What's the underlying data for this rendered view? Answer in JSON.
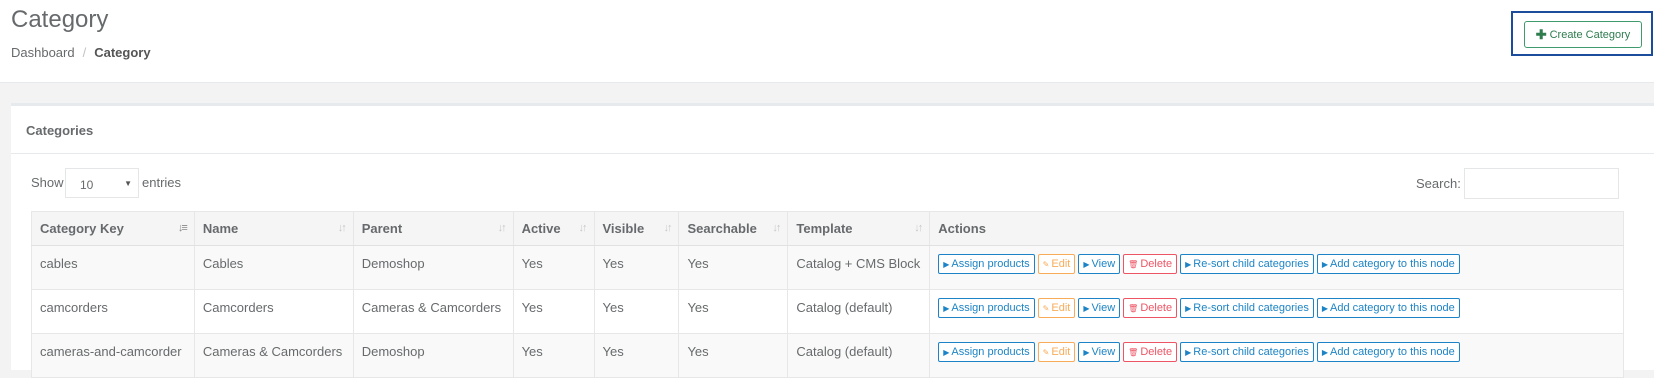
{
  "page": {
    "title": "Category",
    "breadcrumb": [
      "Dashboard",
      "Category"
    ],
    "create_button": "Create Category"
  },
  "box": {
    "title": "Categories",
    "show_label": "Show",
    "page_size": "10",
    "entries_label": "entries",
    "search_label": "Search:",
    "search_value": ""
  },
  "table": {
    "columns": [
      "Category Key",
      "Name",
      "Parent",
      "Active",
      "Visible",
      "Searchable",
      "Template",
      "Actions"
    ],
    "rows": [
      {
        "key": "cables",
        "name": "Cables",
        "parent": "Demoshop",
        "active": "Yes",
        "visible": "Yes",
        "searchable": "Yes",
        "template": "Catalog + CMS Block"
      },
      {
        "key": "camcorders",
        "name": "Camcorders",
        "parent": "Cameras & Camcorders",
        "active": "Yes",
        "visible": "Yes",
        "searchable": "Yes",
        "template": "Catalog (default)"
      },
      {
        "key": "cameras-and-camcorder",
        "name": "Cameras & Camcorders",
        "parent": "Demoshop",
        "active": "Yes",
        "visible": "Yes",
        "searchable": "Yes",
        "template": "Catalog (default)"
      }
    ],
    "actions": {
      "assign": "Assign products",
      "edit": "Edit",
      "view": "View",
      "delete": "Delete",
      "resort": "Re-sort child categories",
      "add": "Add category to this node"
    }
  },
  "icons": {
    "create": "plus-icon",
    "sort": "sort-icon",
    "caret": "caret-right-icon",
    "edit": "edit-icon",
    "delete": "trash-icon"
  },
  "colors": {
    "primary_blue": "#1c84c6",
    "warning_orange": "#f8ac59",
    "danger_red": "#ed5565",
    "create_green": "#2f7c4f",
    "focus_outline": "#1c4c9c"
  }
}
